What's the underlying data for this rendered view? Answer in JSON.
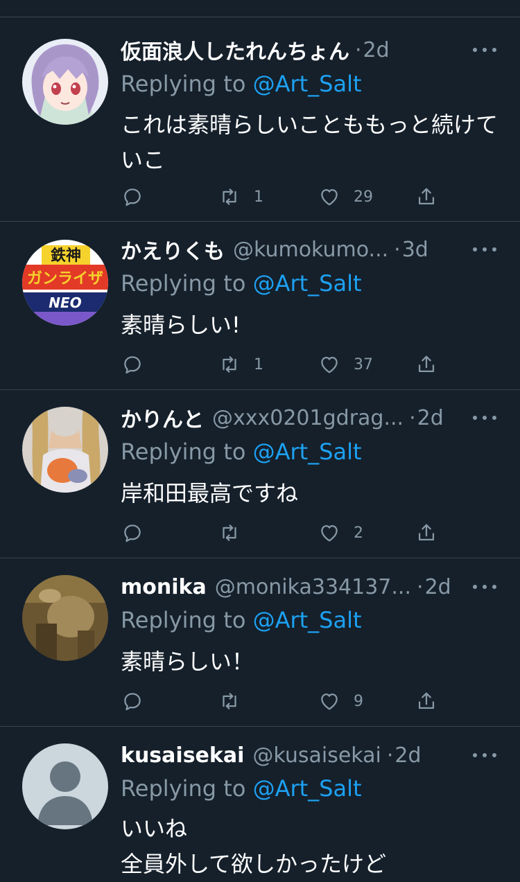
{
  "theme": {
    "background": "#15202b",
    "divider": "#38444d",
    "muted": "#8899a6",
    "link": "#1da1f2"
  },
  "replies": [
    {
      "name": "仮面浪人したれんちょん",
      "handle": "",
      "time": "2d",
      "replying_prefix": "Replying to ",
      "replying_to": "@Art_Salt",
      "text": "これは素晴らしいことももっと続けて\nいこ",
      "reply_count": "",
      "retweet_count": "1",
      "like_count": "29",
      "avatar": "anime-girl-avatar"
    },
    {
      "name": "かえりくも",
      "handle": "@kumokumo...",
      "time": "3d",
      "replying_prefix": "Replying to ",
      "replying_to": "@Art_Salt",
      "text": "素晴らしい!",
      "reply_count": "",
      "retweet_count": "1",
      "like_count": "37",
      "avatar": "game-logo-avatar"
    },
    {
      "name": "かりんと",
      "handle": "@xxx0201gdrag...",
      "time": "2d",
      "replying_prefix": "Replying to ",
      "replying_to": "@Art_Salt",
      "text": "岸和田最高ですね",
      "reply_count": "",
      "retweet_count": "",
      "like_count": "2",
      "avatar": "photo-avatar"
    },
    {
      "name": "monika",
      "handle": "@monika334137...",
      "time": "2d",
      "replying_prefix": "Replying to ",
      "replying_to": "@Art_Salt",
      "text": "素晴らしい！",
      "reply_count": "",
      "retweet_count": "",
      "like_count": "9",
      "avatar": "photo-avatar"
    },
    {
      "name": "kusaisekai",
      "handle": "@kusaisekai",
      "time": "2d",
      "replying_prefix": "Replying to ",
      "replying_to": "@Art_Salt",
      "text": "いいね\n全員外して欲しかったけど",
      "reply_count": "",
      "retweet_count": "",
      "like_count": "",
      "avatar": "default-avatar"
    }
  ],
  "separator": "·"
}
